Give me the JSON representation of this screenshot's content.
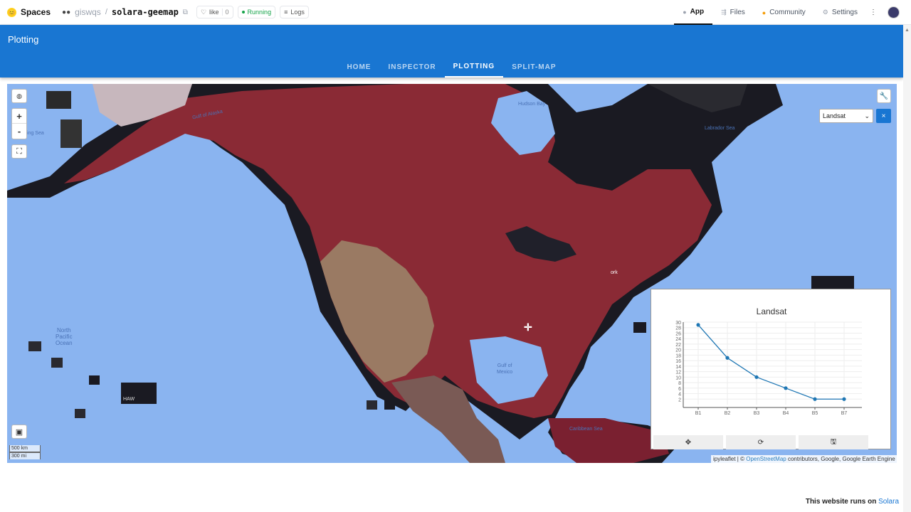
{
  "hf": {
    "brand": "Spaces",
    "owner": "giswqs",
    "repo": "solara-geemap",
    "like_label": "like",
    "like_count": "0",
    "status": "Running",
    "logs_label": "Logs",
    "tabs": [
      {
        "label": "App",
        "icon": "app-icon"
      },
      {
        "label": "Files",
        "icon": "files-icon"
      },
      {
        "label": "Community",
        "icon": "community-icon"
      },
      {
        "label": "Settings",
        "icon": "settings-icon"
      }
    ],
    "more": "⋮"
  },
  "app": {
    "title": "Plotting",
    "tabs": [
      "HOME",
      "INSPECTOR",
      "PLOTTING",
      "SPLIT-MAP"
    ],
    "active_tab": "PLOTTING",
    "accent": "#1976d2"
  },
  "map": {
    "zoom_in": "+",
    "zoom_out": "-",
    "layer_select": "Landsat",
    "layer_close": "×",
    "scale_km": "500 km",
    "scale_mi": "300 mi",
    "attribution_prefix": "ipyleaflet | ©",
    "attribution_link": "OpenStreetMap",
    "attribution_suffix": "contributors, Google, Google Earth Engine",
    "labels": {
      "gulf_alaska": "Gulf of Alaska",
      "bering": "ing Sea",
      "hudson": "Hudson Bay",
      "labrador": "Labrador Sea",
      "north_pacific": [
        "North",
        "Pacific",
        "Ocean"
      ],
      "gulf_mexico": [
        "Gulf of",
        "Mexico"
      ],
      "caribbean": "Caribbean Sea",
      "hawaii": "HAW",
      "ork": "ork"
    }
  },
  "chart_data": {
    "type": "line",
    "title": "Landsat",
    "categories": [
      "B1",
      "B2",
      "B3",
      "B4",
      "B5",
      "B7"
    ],
    "values": [
      29,
      17,
      10,
      6,
      2,
      2
    ],
    "ylim": [
      0,
      30
    ],
    "yticks": [
      2,
      4,
      6,
      8,
      10,
      12,
      14,
      16,
      18,
      20,
      22,
      24,
      26,
      28,
      30
    ],
    "color": "#1f77b4",
    "grid": true
  },
  "chart_toolbar": {
    "pan": "✥",
    "reset": "⟳",
    "save": "🖫"
  },
  "footer": {
    "text": "This website runs on",
    "link": "Solara"
  }
}
